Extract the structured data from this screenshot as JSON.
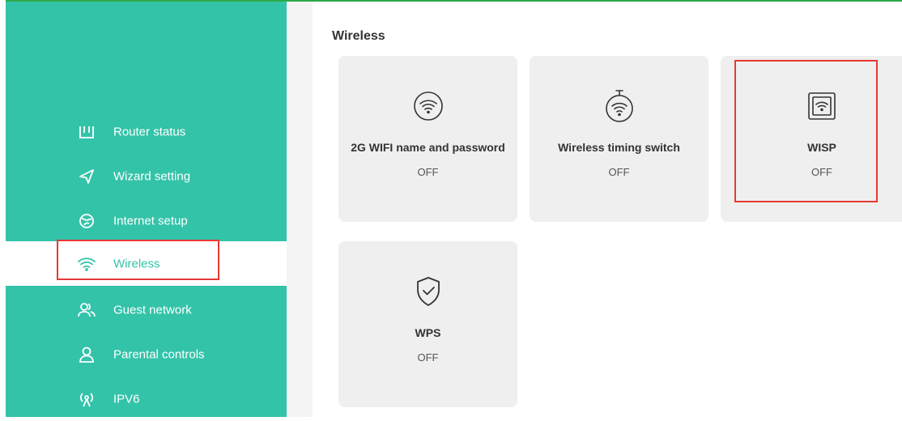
{
  "sidebar": {
    "items": [
      {
        "label": "Router status",
        "icon": "router-icon"
      },
      {
        "label": "Wizard setting",
        "icon": "send-icon"
      },
      {
        "label": "Internet setup",
        "icon": "globe-icon"
      },
      {
        "label": "Wireless",
        "icon": "wifi-icon",
        "active": true
      },
      {
        "label": "Guest network",
        "icon": "users-icon"
      },
      {
        "label": "Parental controls",
        "icon": "user-icon"
      },
      {
        "label": "IPV6",
        "icon": "antenna-icon"
      }
    ],
    "color": "#33c3a9"
  },
  "main": {
    "title": "Wireless",
    "cards": [
      {
        "title": "2G WIFI name and password",
        "status": "OFF",
        "icon": "wifi-circle-icon"
      },
      {
        "title": "Wireless timing switch",
        "status": "OFF",
        "icon": "wifi-timer-icon"
      },
      {
        "title": "WISP",
        "status": "OFF",
        "icon": "wisp-icon"
      },
      {
        "title": "WPS",
        "status": "OFF",
        "icon": "shield-check-icon"
      }
    ]
  },
  "colors": {
    "accent": "#33c3a9",
    "highlight": "#e53935",
    "card_bg": "#efefef"
  }
}
